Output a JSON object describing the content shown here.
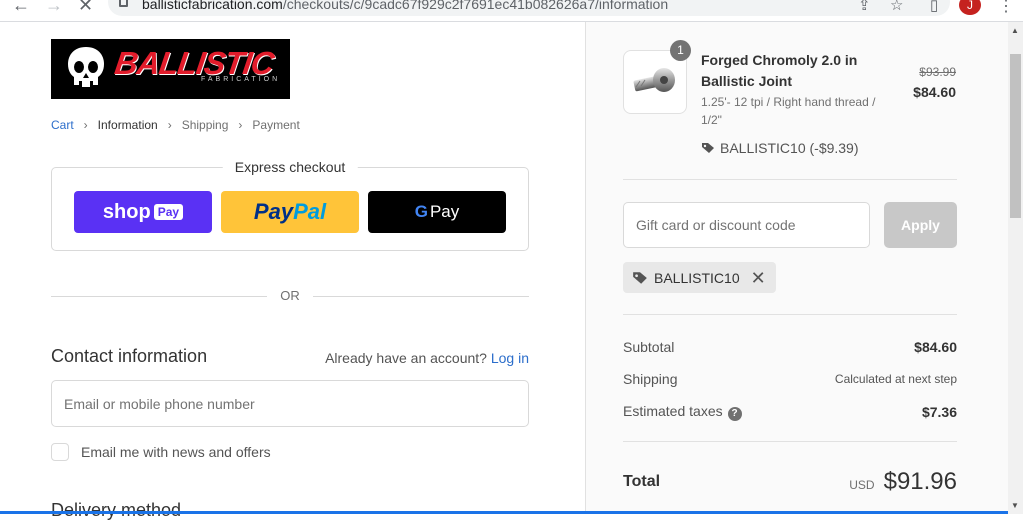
{
  "browser": {
    "url_host": "ballisticfabrication.com",
    "url_path": "/checkouts/c/9cadc67f929c2f7691ec41b082626a7/information",
    "avatar_letter": "J",
    "icons": [
      "back-arrow-icon",
      "forward-arrow-icon",
      "stop-icon",
      "lock-icon",
      "share-icon",
      "star-icon",
      "sidepanel-icon",
      "kebab-menu-icon"
    ]
  },
  "store": {
    "logo_text": "BALLISTIC",
    "logo_subtext": "FABRICATION"
  },
  "breadcrumb": [
    {
      "label": "Cart",
      "state": "link"
    },
    {
      "label": "Information",
      "state": "current"
    },
    {
      "label": "Shipping",
      "state": "upcoming"
    },
    {
      "label": "Payment",
      "state": "upcoming"
    }
  ],
  "express": {
    "title": "Express checkout",
    "shop_pay": {
      "word": "shop",
      "badge": "Pay"
    },
    "paypal": {
      "part1": "Pay",
      "part2": "Pal"
    },
    "gpay": {
      "g": "G",
      "label": "Pay"
    }
  },
  "divider_text": "OR",
  "contact": {
    "title": "Contact information",
    "account_prompt": "Already have an account?",
    "login_label": "Log in",
    "email_placeholder": "Email or mobile phone number",
    "newsletter_label": "Email me with news and offers",
    "newsletter_checked": false
  },
  "delivery": {
    "title": "Delivery method"
  },
  "order": {
    "item": {
      "quantity": "1",
      "name": "Forged Chromoly 2.0 in Ballistic Joint",
      "variant": "1.25'- 12 tpi / Right hand thread / 1/2\"",
      "price_original": "$93.99",
      "price_final": "$84.60",
      "discount_line": "BALLISTIC10 (-$9.39)"
    },
    "discount_placeholder": "Gift card or discount code",
    "apply_label": "Apply",
    "applied_code": "BALLISTIC10",
    "subtotal_label": "Subtotal",
    "subtotal_value": "$84.60",
    "shipping_label": "Shipping",
    "shipping_value": "Calculated at next step",
    "taxes_label": "Estimated taxes",
    "taxes_value": "$7.36",
    "total_label": "Total",
    "total_currency": "USD",
    "total_value": "$91.96"
  },
  "colors": {
    "link": "#2c6ecb",
    "shop_pay": "#5a31f4",
    "paypal": "#ffc439",
    "gpay": "#000000",
    "brand_red": "#e21c2b"
  }
}
